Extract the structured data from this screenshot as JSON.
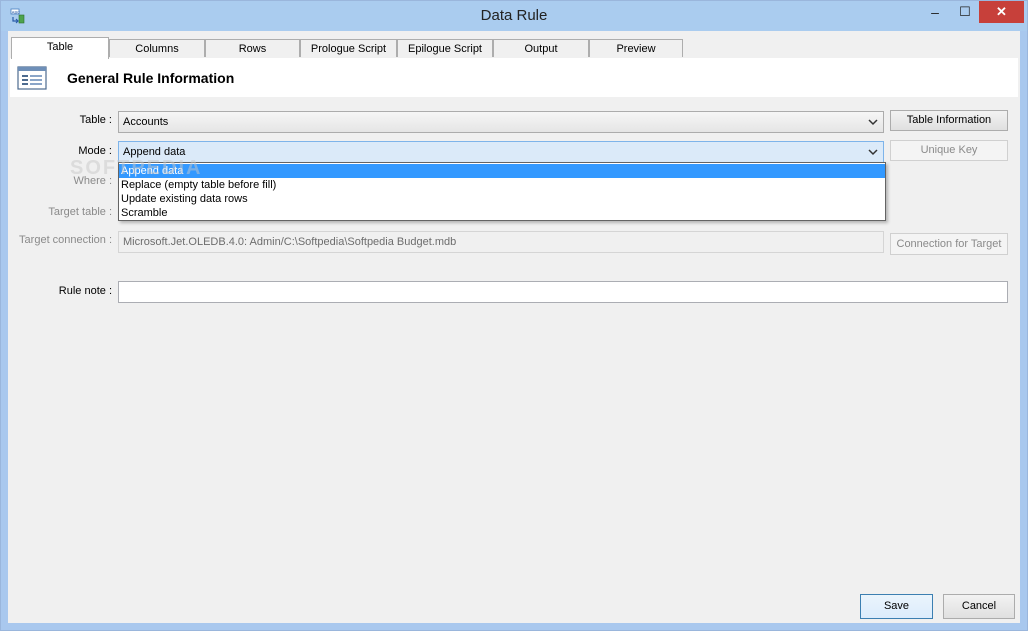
{
  "window": {
    "title": "Data Rule",
    "app_icon": "data-rule-app-icon",
    "minimize_glyph": "–",
    "maximize_glyph": "☐",
    "close_glyph": "✕"
  },
  "tabs": [
    {
      "label": "Table",
      "active": true
    },
    {
      "label": "Columns",
      "active": false
    },
    {
      "label": "Rows",
      "active": false
    },
    {
      "label": "Prologue Script",
      "active": false
    },
    {
      "label": "Epilogue Script",
      "active": false
    },
    {
      "label": "Output",
      "active": false
    },
    {
      "label": "Preview",
      "active": false
    }
  ],
  "section": {
    "title": "General Rule Information",
    "icon": "form-icon"
  },
  "form": {
    "table_label": "Table :",
    "table_value": "Accounts",
    "mode_label": "Mode :",
    "mode_value": "Append data",
    "where_label": "Where :",
    "target_table_label": "Target table :",
    "target_connection_label": "Target connection :",
    "target_connection_value": "Microsoft.Jet.OLEDB.4.0: Admin/C:\\Softpedia\\Softpedia Budget.mdb",
    "rule_note_label": "Rule note :",
    "rule_note_value": ""
  },
  "mode_options": [
    {
      "label": "Append data",
      "selected": true
    },
    {
      "label": "Replace (empty table before fill)",
      "selected": false
    },
    {
      "label": "Update existing data rows",
      "selected": false
    },
    {
      "label": "Scramble",
      "selected": false
    }
  ],
  "buttons": {
    "table_information": "Table Information",
    "unique_key": "Unique Key",
    "connection_for_target": "Connection for Target",
    "save": "Save",
    "cancel": "Cancel"
  },
  "watermark": "SOFTPEDIA",
  "colors": {
    "selection": "#3399ff",
    "close_button": "#c7403a",
    "titlebar": "#aaccef"
  }
}
